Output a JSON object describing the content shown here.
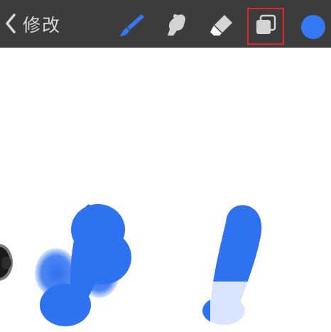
{
  "toolbar": {
    "back_label": "修改",
    "icons": {
      "back": "chevron-left-icon",
      "brush": "brush-icon",
      "smudge": "smudge-icon",
      "eraser": "eraser-icon",
      "layers": "layers-icon"
    },
    "selected_color": "#3478f6",
    "highlight_color": "#e0262b"
  },
  "canvas": {
    "stroke_color": "#2f72f0",
    "background": "#ffffff"
  }
}
